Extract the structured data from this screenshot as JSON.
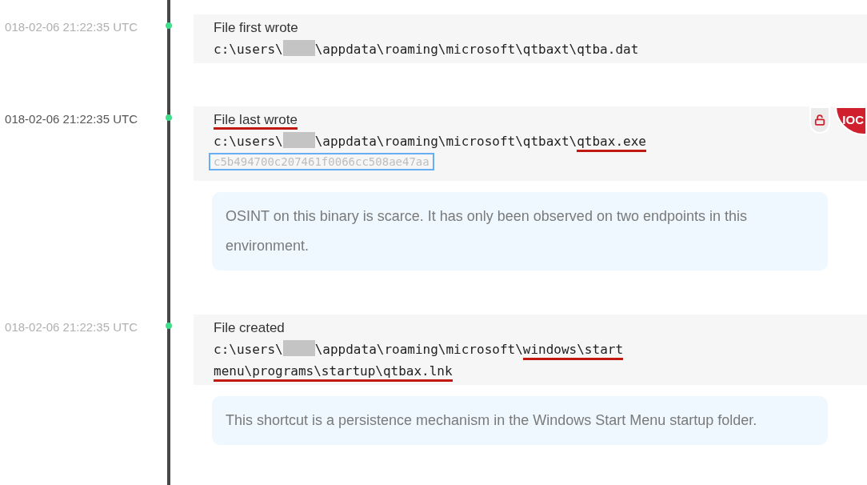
{
  "events": [
    {
      "timestamp": "018-02-06 21:22:35 UTC",
      "highlighted": false,
      "title": "File first wrote",
      "title_underlined": false,
      "path": [
        [
          {
            "kind": "text",
            "text": "c:\\users\\",
            "underlined": false
          },
          {
            "kind": "redacted"
          },
          {
            "kind": "text",
            "text": "\\appdata\\roaming\\microsoft\\qtbaxt\\qtba.dat",
            "underlined": false
          }
        ]
      ]
    },
    {
      "timestamp": "018-02-06 21:22:35 UTC",
      "highlighted": true,
      "title": "File last wrote",
      "title_underlined": true,
      "path": [
        [
          {
            "kind": "text",
            "text": "c:\\users\\",
            "underlined": false
          },
          {
            "kind": "redacted"
          },
          {
            "kind": "text",
            "text": "\\appdata\\roaming\\microsoft\\qtbaxt\\",
            "underlined": false
          },
          {
            "kind": "text",
            "text": "qtbax.exe",
            "underlined": true
          }
        ]
      ],
      "hash": "c5b494700c207461f0066cc508ae47aa",
      "badges": [
        {
          "kind": "lock"
        },
        {
          "kind": "label",
          "text": "IOC"
        }
      ],
      "note": "OSINT on this binary is scarce. It has only been observed on two endpoints in this environment."
    },
    {
      "timestamp": "018-02-06 21:22:35 UTC",
      "highlighted": false,
      "title": "File created",
      "title_underlined": false,
      "path": [
        [
          {
            "kind": "text",
            "text": "c:\\users\\",
            "underlined": false
          },
          {
            "kind": "redacted"
          },
          {
            "kind": "text",
            "text": "\\appdata\\roaming\\microsoft\\",
            "underlined": false
          },
          {
            "kind": "text",
            "text": "windows\\start",
            "underlined": true
          }
        ],
        [
          {
            "kind": "text",
            "text": "menu\\programs\\startup\\qtbax.lnk",
            "underlined": true
          }
        ]
      ],
      "note": "This shortcut is a persistence mechanism in the Windows Start Menu startup folder."
    }
  ]
}
